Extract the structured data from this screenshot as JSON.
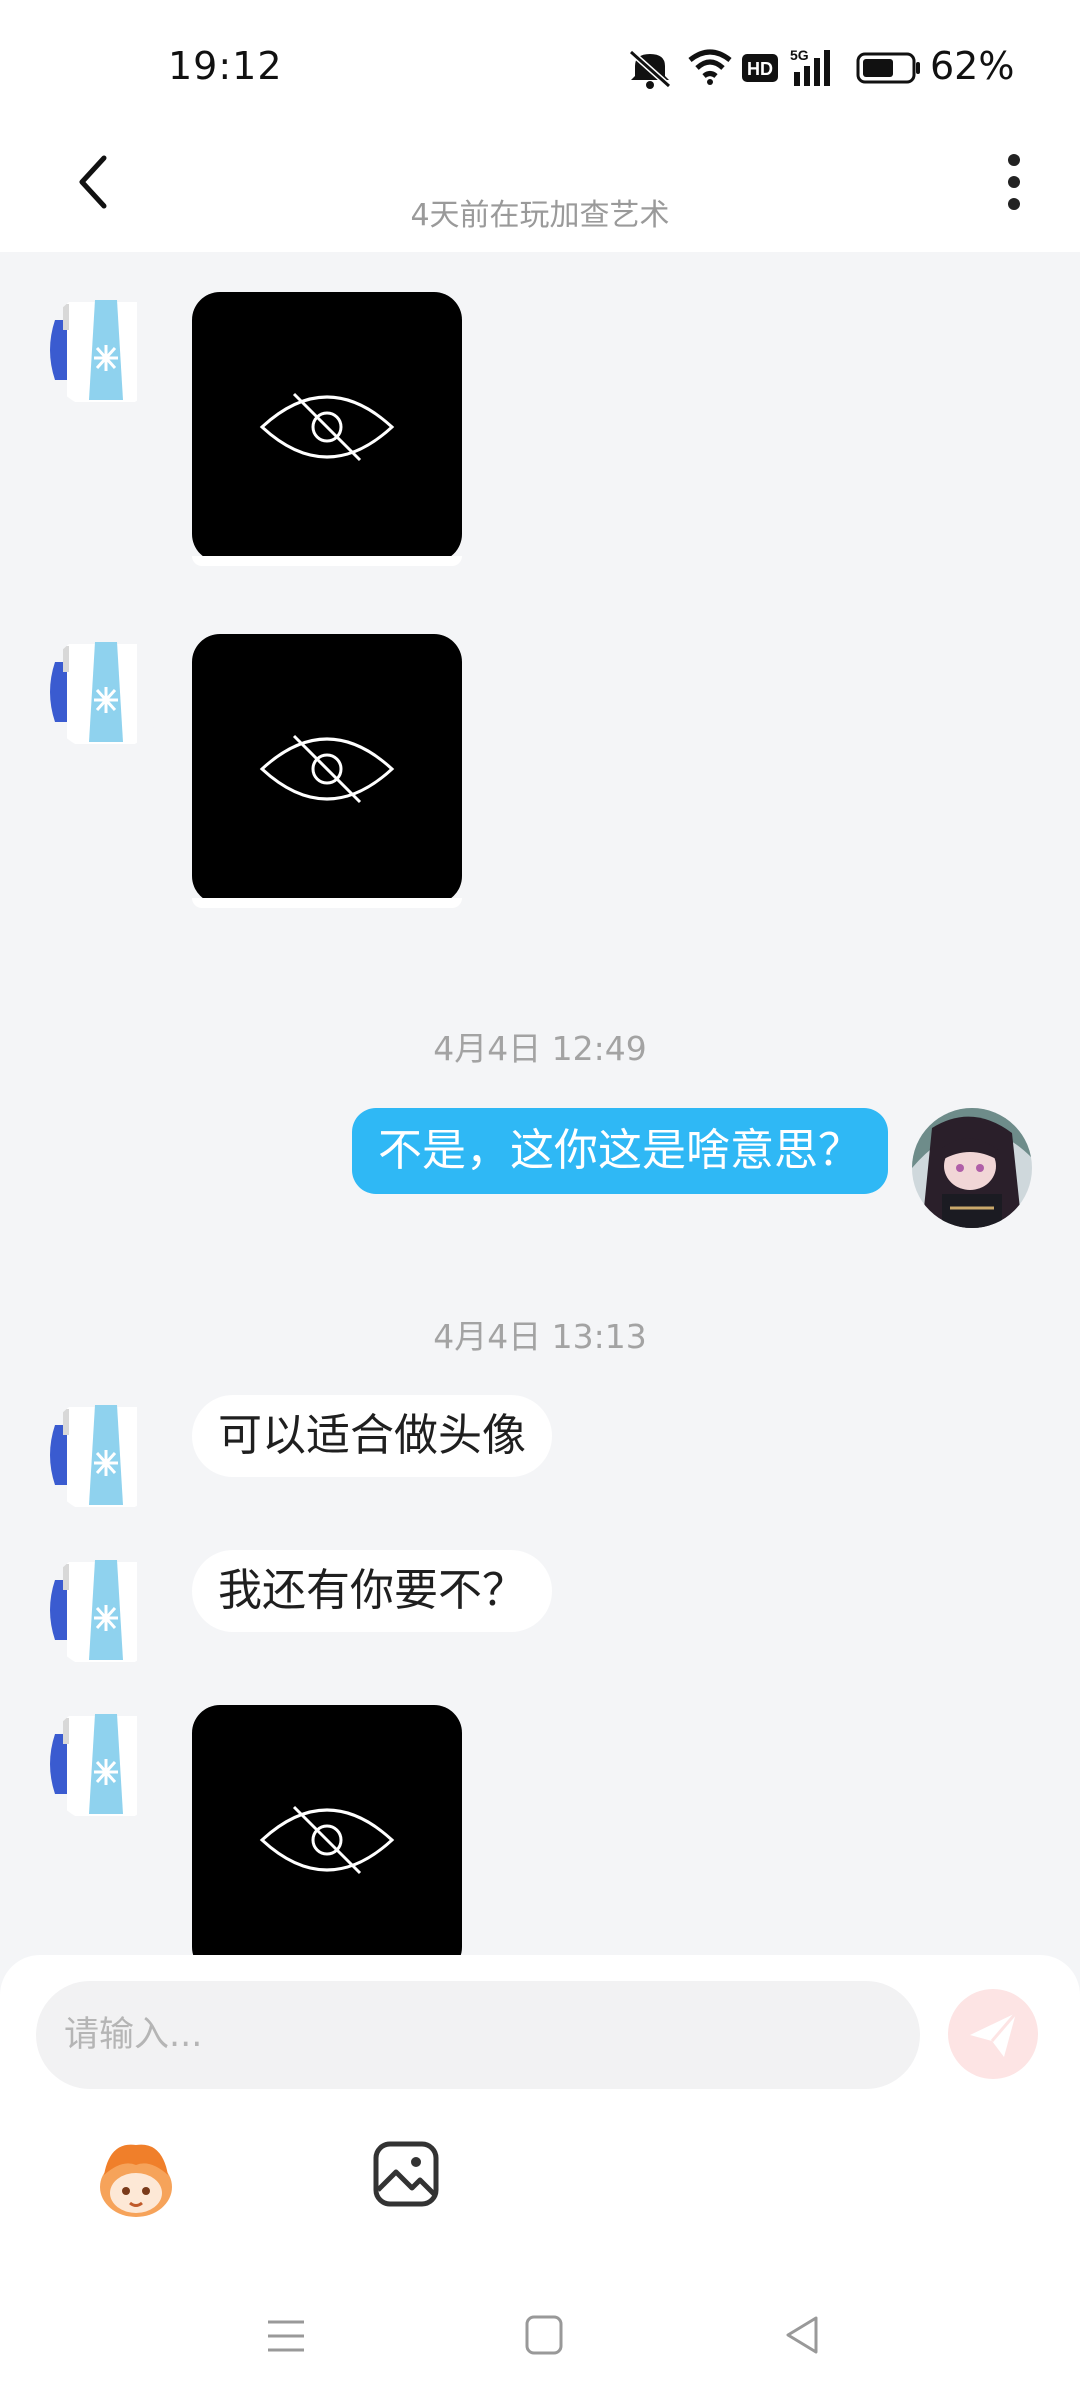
{
  "status_bar": {
    "time": "19:12",
    "battery": "62%",
    "icons": [
      "mute-icon",
      "wifi-icon",
      "hd-icon",
      "signal-5g-icon",
      "battery-icon"
    ]
  },
  "header": {
    "subtitle": "4天前在玩加查艺术"
  },
  "messages": [
    {
      "type": "image",
      "side": "left"
    },
    {
      "type": "image",
      "side": "left"
    },
    {
      "type": "time",
      "text": "4月4日 12:49"
    },
    {
      "type": "text",
      "side": "right",
      "text": "不是，这你这是啥意思？"
    },
    {
      "type": "time",
      "text": "4月4日 13:13"
    },
    {
      "type": "text",
      "side": "left",
      "text": "可以适合做头像"
    },
    {
      "type": "text",
      "side": "left",
      "text": "我还有你要不？"
    },
    {
      "type": "image",
      "side": "left"
    }
  ],
  "composer": {
    "placeholder": "请输入...",
    "accent": "#2fb8f5"
  }
}
